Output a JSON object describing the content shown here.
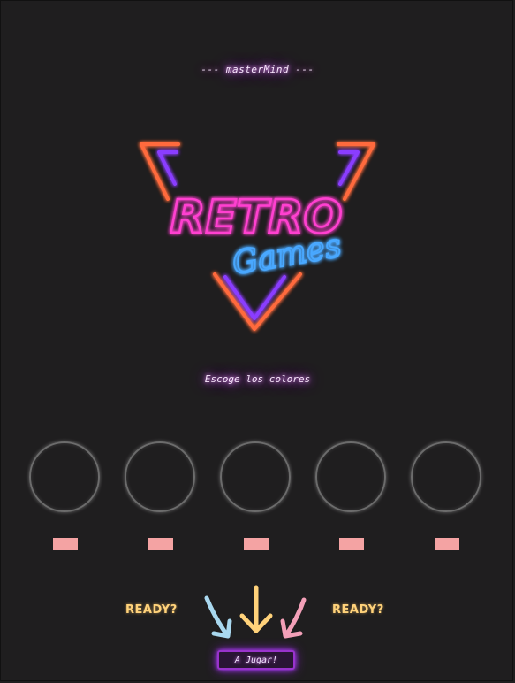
{
  "header": {
    "subtitle": "--- masterMind ---"
  },
  "logo": {
    "title": "RETRO",
    "subtitle": "Games",
    "colors": {
      "pink": "#ff3fd0",
      "orange": "#ff6a3d",
      "purple": "#8a3cff",
      "blue": "#4aa8ff"
    }
  },
  "instructions": {
    "text": "Escoge los colores"
  },
  "slots": [
    {
      "id": 1
    },
    {
      "id": 2
    },
    {
      "id": 3
    },
    {
      "id": 4
    },
    {
      "id": 5
    }
  ],
  "swatches": [
    {
      "color": "#f4a3a3"
    },
    {
      "color": "#f4a3a3"
    },
    {
      "color": "#f4a3a3"
    },
    {
      "color": "#f4a3a3"
    },
    {
      "color": "#f4a3a3"
    }
  ],
  "prompt": {
    "left": "READY?",
    "right": "READY?"
  },
  "arrows": {
    "left": "#a9d8ef",
    "center": "#ffd27a",
    "right": "#f3a0b8"
  },
  "play_button": {
    "label": "A Jugar!"
  }
}
